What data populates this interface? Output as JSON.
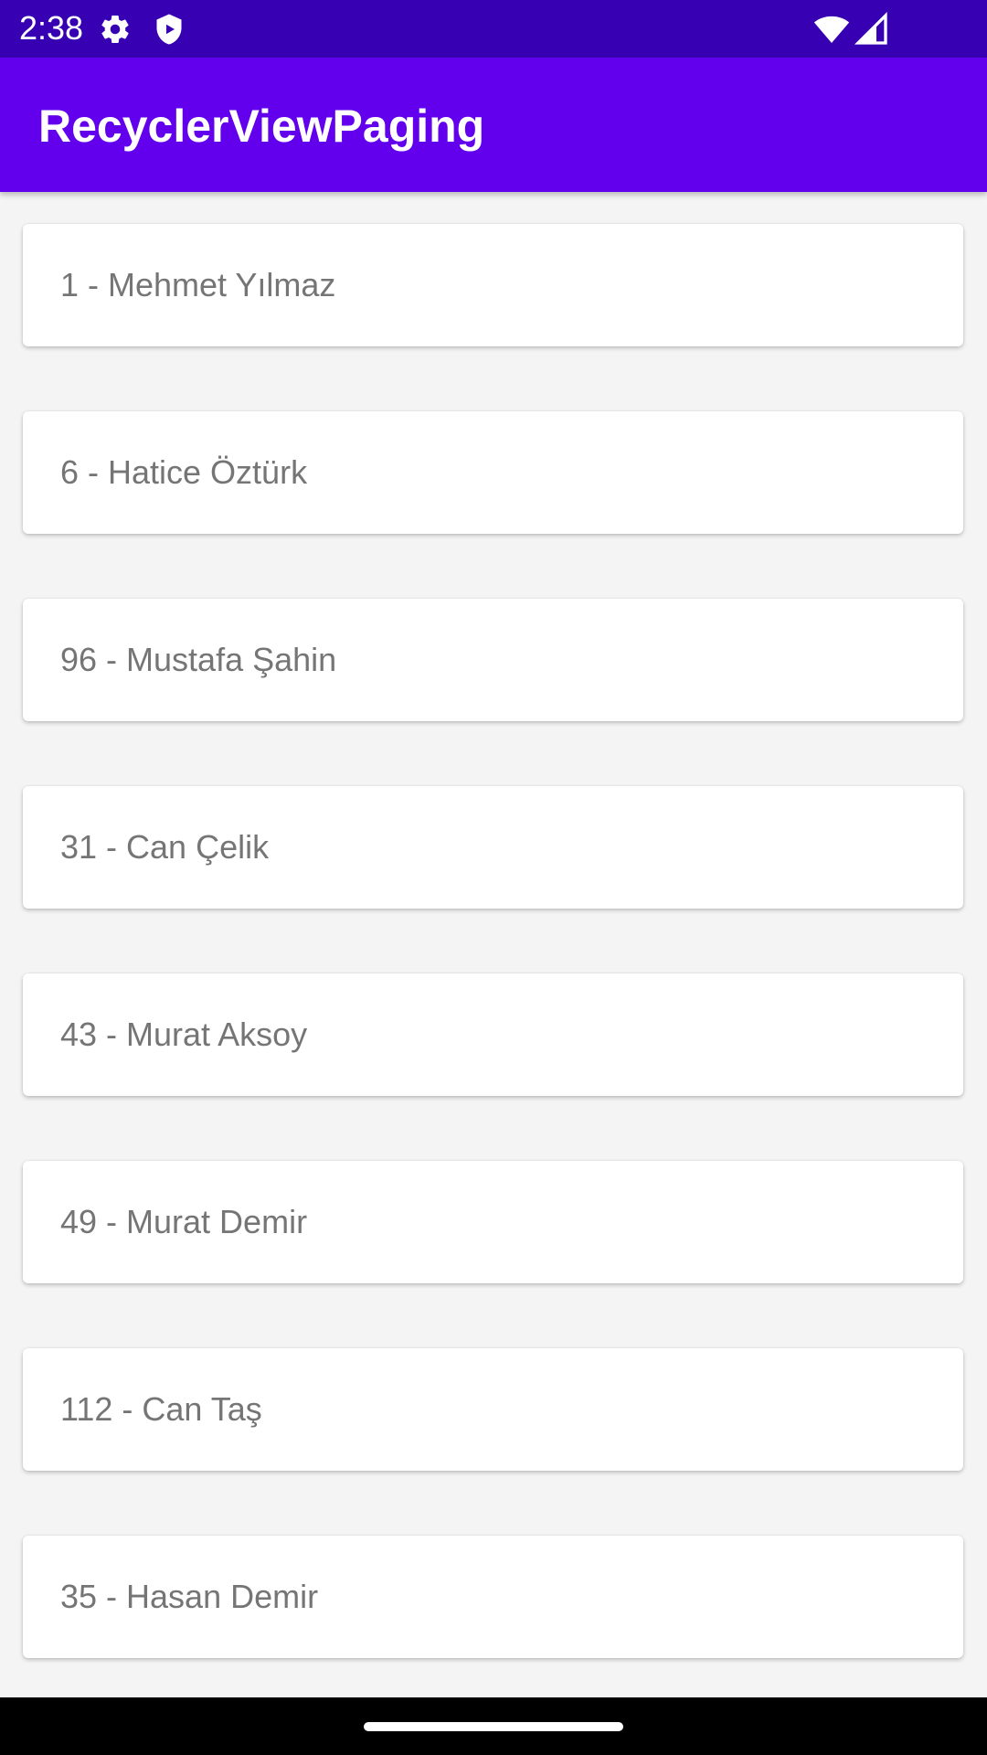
{
  "status_bar": {
    "time": "2:38",
    "icons": [
      "settings-gear-icon",
      "shield-icon",
      "wifi-icon",
      "cell-signal-icon"
    ],
    "background": "#3700b3"
  },
  "app_bar": {
    "title": "RecyclerViewPaging",
    "background": "#6200ee"
  },
  "list": {
    "items": [
      {
        "label": "1 - Mehmet Yılmaz"
      },
      {
        "label": "6 - Hatice Öztürk"
      },
      {
        "label": "96 - Mustafa Şahin"
      },
      {
        "label": "31 - Can Çelik"
      },
      {
        "label": "43 - Murat Aksoy"
      },
      {
        "label": "49 - Murat Demir"
      },
      {
        "label": "112 - Can Taş"
      },
      {
        "label": "35 - Hasan Demir"
      }
    ]
  }
}
